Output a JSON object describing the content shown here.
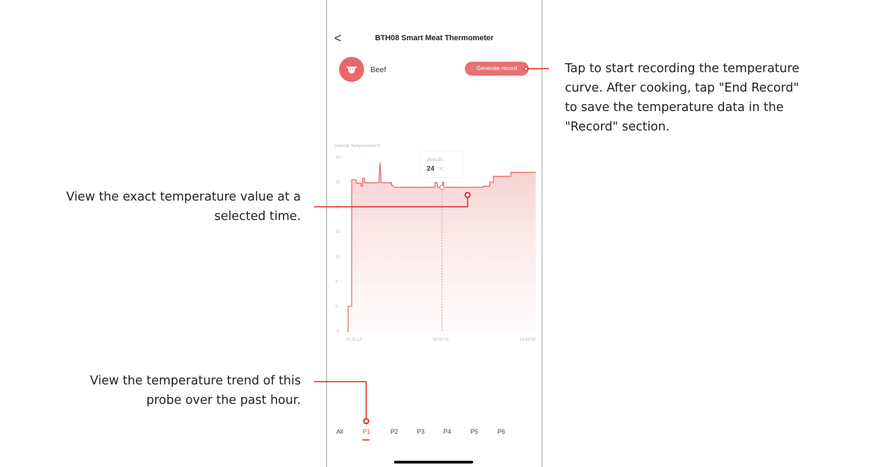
{
  "header": {
    "back_label": "<",
    "title": "BTH08 Smart Meat Thermometer"
  },
  "meat": {
    "icon": "cow-head-icon",
    "name": "Beef"
  },
  "generate_button": {
    "label": "Generate record"
  },
  "chart_data": {
    "type": "line",
    "title": "",
    "ylabel": "Internal Temperature°C",
    "ylim": [
      -5,
      30
    ],
    "y_ticks": [
      "30",
      "25",
      "20",
      "15",
      "10",
      "5",
      "0",
      "-5"
    ],
    "x_tick_labels": [
      "16:15:12",
      "16:35:43",
      "16:58:55"
    ],
    "series": [
      {
        "x": [
          0,
          0.6,
          0.6,
          2.0,
          2.0,
          3.5,
          4.0,
          4.0,
          5.8,
          5.8,
          6.4,
          6.4,
          7.2,
          7.2,
          12.9,
          13.4,
          13.8,
          13.8,
          18.0,
          18.0,
          18.5,
          19.0,
          19.2,
          19.6,
          19.6,
          35.5,
          35.5,
          36.0,
          36.2,
          36.5,
          36.5,
          38.5,
          38.5,
          39.0,
          39.0,
          55.0,
          55.0,
          57.5,
          57.5,
          59.0,
          59.0,
          64.0,
          66.0,
          66.0,
          76.0
        ],
        "y": [
          -5,
          -5,
          0,
          0,
          25.5,
          25.5,
          25.3,
          24.8,
          24.8,
          24.2,
          24.2,
          25.8,
          25.8,
          24.9,
          24.9,
          29.0,
          25.3,
          24.9,
          24.9,
          24.4,
          24.4,
          24.0,
          24.0,
          24.0,
          24.0,
          24.0,
          25.0,
          25.0,
          24.8,
          24.8,
          24.0,
          24.0,
          25.0,
          25.0,
          24.0,
          24.0,
          24.2,
          24.2,
          25.0,
          25.0,
          26.2,
          26.2,
          26.2,
          27.0,
          27.0
        ]
      }
    ],
    "selected": {
      "time": "16:42:51",
      "value": "24",
      "unit": "℃"
    }
  },
  "probe_tabs": [
    {
      "label": "All",
      "active": false
    },
    {
      "label": "P1",
      "active": true
    },
    {
      "label": "P2",
      "active": false
    },
    {
      "label": "P3",
      "active": false
    },
    {
      "label": "P4",
      "active": false
    },
    {
      "label": "P5",
      "active": false
    },
    {
      "label": "P6",
      "active": false
    }
  ],
  "annotations": {
    "generate_record": [
      "Tap to start recording the temperature",
      "curve. After cooking, tap \"End Record\"",
      "to save the temperature data in the",
      "\"Record\" section."
    ],
    "exact_value": [
      "View the exact temperature value at a",
      "selected time."
    ],
    "trend": [
      "View the temperature trend of this",
      "probe over the past hour."
    ]
  },
  "colors": {
    "accent": "#e9676a",
    "callout": "#e02020",
    "tab_active": "#e9583f"
  }
}
